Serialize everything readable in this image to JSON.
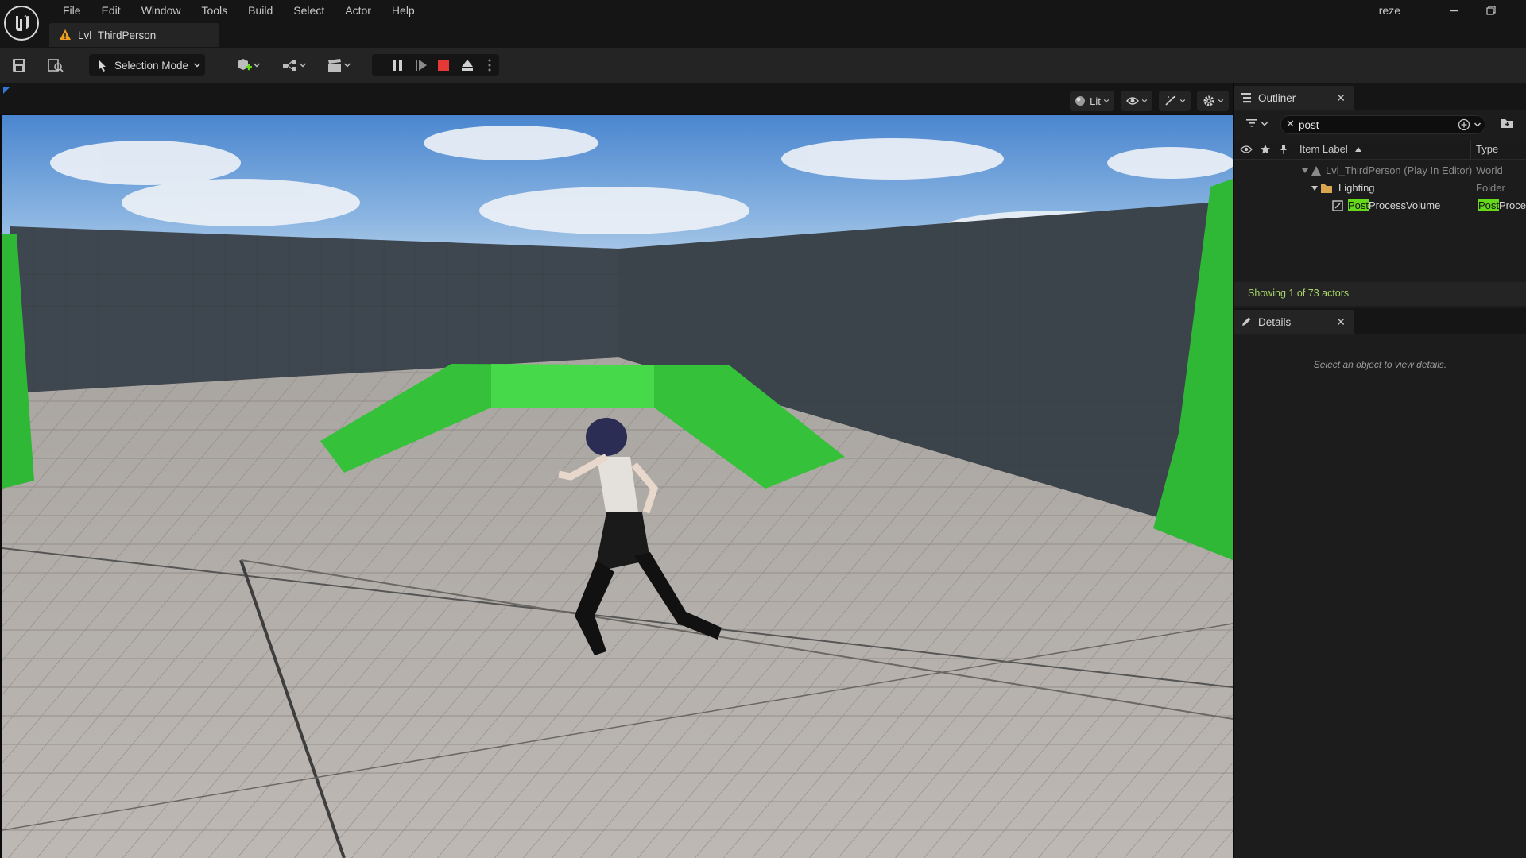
{
  "app": {
    "user": "reze"
  },
  "menu": [
    "File",
    "Edit",
    "Window",
    "Tools",
    "Build",
    "Select",
    "Actor",
    "Help"
  ],
  "level_tab": {
    "name": "Lvl_ThirdPerson"
  },
  "toolbar": {
    "selection_mode": "Selection Mode"
  },
  "viewport": {
    "lit_label": "Lit"
  },
  "outliner": {
    "title": "Outliner",
    "search": {
      "value": "post"
    },
    "columns": {
      "label": "Item Label",
      "type": "Type"
    },
    "rows": [
      {
        "label": "Lvl_ThirdPerson (Play In Editor)",
        "type": "World"
      },
      {
        "label": "Lighting",
        "type": "Folder"
      },
      {
        "label_highlight": "Post",
        "label_rest": "ProcessVolume",
        "type_highlight": "Post",
        "type_rest": "ProcessVolume"
      }
    ],
    "status": "Showing 1 of 73 actors"
  },
  "details": {
    "title": "Details",
    "empty_message": "Select an object to view details."
  },
  "colors": {
    "accent_green": "#65d91a",
    "status_green": "#a9d66b",
    "stop_red": "#e53935",
    "warning_orange": "#f0a020"
  }
}
